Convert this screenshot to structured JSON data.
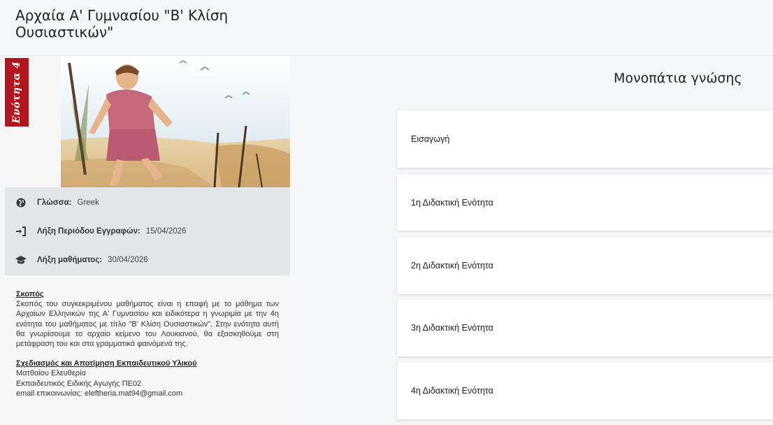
{
  "header": {
    "title": "Αρχαία Α' Γυμνασίου \"Β' Κλίση Ουσιαστικών\""
  },
  "hero": {
    "unit_tag": "Ενότητα 4"
  },
  "info": {
    "language": {
      "label": "Γλώσσα:",
      "value": "Greek",
      "icon": "globe-icon"
    },
    "enrollment": {
      "label": "Λήξη Περιόδου Εγγραφών:",
      "value": "15/04/2026",
      "icon": "sign-in-icon"
    },
    "course_end": {
      "label": "Λήξη μαθήματος:",
      "value": "30/04/2026",
      "icon": "graduation-cap-icon"
    }
  },
  "description": {
    "goal_heading": "Σκοπός",
    "goal_text": "Σκοπός του συγκεκριμένου μαθήματος είναι η επαφή με το μάθημα των Αρχαίων Ελληνικών της Α' Γυμνασίου και ειδικότερα η γνωριμία με την 4η ενότητα του μαθήματος με τίτλο \"Β' Κλίση Ουσιαστικών\". Στην ενότητα αυτή θα  γνωρίσουμε το αρχαίο κείμενο του Λουκιανού, θα εξασκηθούμε στη μετάφραση του και στα γραμματικά φαινόμενά της.",
    "design_heading": "Σχεδιασμός και Αποτίμηση Εκπαιδευτικού Υλικού",
    "author": "Ματθαίου Ελευθερία",
    "role": "Εκπαιδευτικός Ειδικής Αγωγής ΠΕ02",
    "email": "email επικοινωνίας: eleftheria.mat94@gmail.com"
  },
  "paths": {
    "title": "Μονοπάτια γνώσης",
    "items": [
      {
        "label": "Εισαγωγή"
      },
      {
        "label": "1η Διδακτική Ενότητα"
      },
      {
        "label": "2η Διδακτική Ενότητα"
      },
      {
        "label": "3η Διδακτική Ενότητα"
      },
      {
        "label": "4η Διδακτική Ενότητα"
      }
    ]
  },
  "colors": {
    "unit_tag": "#b0161e",
    "info_bg": "#e4e5e8",
    "page_bg": "#f5f6f8"
  }
}
